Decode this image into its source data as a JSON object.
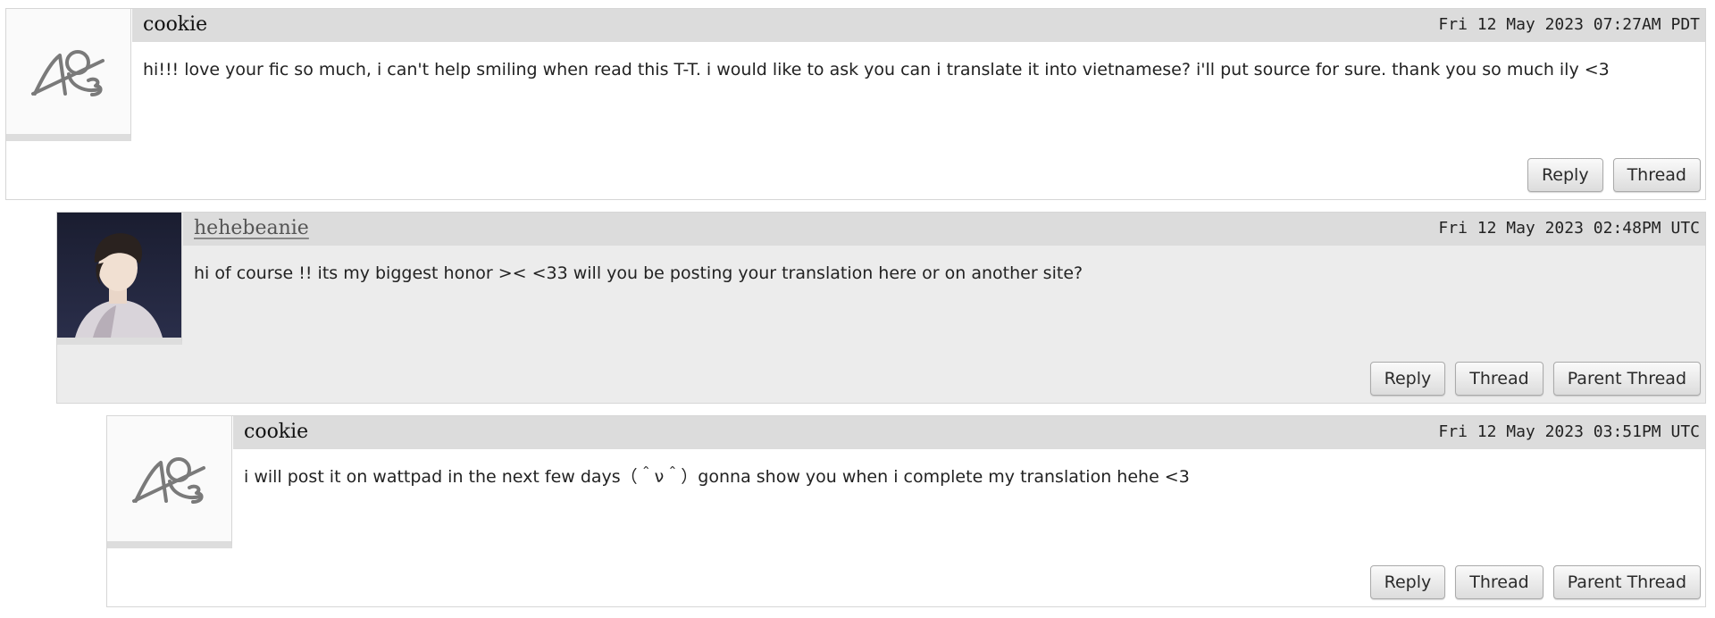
{
  "comments": [
    {
      "author": "cookie",
      "datetime": "Fri 12 May 2023 07:27AM PDT",
      "text": "hi!!! love your fic so much, i can't help smiling when read this T-T. i would like to ask you can i translate it into vietnamese? i'll put source for sure. thank you so much ily <3",
      "actions": {
        "reply": "Reply",
        "thread": "Thread"
      }
    },
    {
      "author": "hehebeanie",
      "datetime": "Fri 12 May 2023 02:48PM UTC",
      "text": "hi of course !! its my biggest honor >< <33 will you be posting your translation here or on another site?",
      "actions": {
        "reply": "Reply",
        "thread": "Thread",
        "parent_thread": "Parent Thread"
      }
    },
    {
      "author": "cookie",
      "datetime": "Fri 12 May 2023 03:51PM UTC",
      "text": "i will post it on wattpad in the next few days（＾ν＾）gonna show you when i complete my translation hehe <3",
      "actions": {
        "reply": "Reply",
        "thread": "Thread",
        "parent_thread": "Parent Thread"
      }
    }
  ],
  "icons": {
    "guest": "ao3-default-user-icon",
    "user": "user-avatar-photo"
  }
}
